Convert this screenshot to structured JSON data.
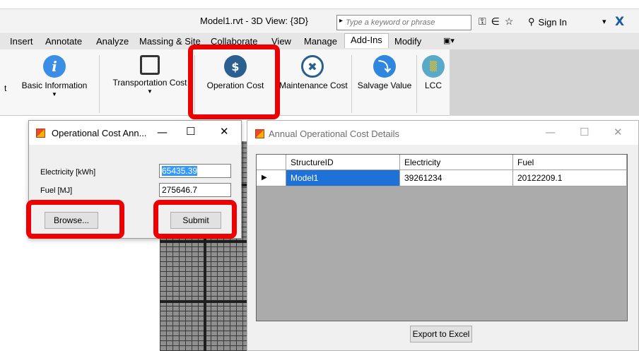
{
  "titlebar": {
    "app_title": "Model1.rvt - 3D View: {3D}",
    "search_placeholder": "Type a keyword or phrase",
    "sign_in": "Sign In"
  },
  "ribbon": {
    "tabs": [
      {
        "label": "Insert"
      },
      {
        "label": "Annotate"
      },
      {
        "label": "Analyze"
      },
      {
        "label": "Massing & Site"
      },
      {
        "label": "Collaborate"
      },
      {
        "label": "View"
      },
      {
        "label": "Manage"
      },
      {
        "label": "Add-Ins",
        "active": true
      },
      {
        "label": "Modify"
      }
    ],
    "buttons": [
      {
        "label": "Basic Information",
        "icon": "info-icon",
        "color": "#3a8ee6"
      },
      {
        "label": "Transportation Cost",
        "icon": "truck-icon",
        "color": "#333333"
      },
      {
        "label": "Operation Cost",
        "icon": "money-hand-icon",
        "color": "#2b5f8f"
      },
      {
        "label": "Maintenance Cost",
        "icon": "tools-icon",
        "color": "#2b5f8f"
      },
      {
        "label": "Salvage Value",
        "icon": "salvage-arrow-icon",
        "color": "#2e86de"
      },
      {
        "label": "LCC",
        "icon": "bar-chart-icon",
        "color": "#5aa9c9"
      }
    ]
  },
  "dialog_small": {
    "title": "Operational Cost Ann...",
    "electricity_label": "Electricity [kWh]",
    "electricity_value": "65435.39",
    "fuel_label": "Fuel [MJ]",
    "fuel_value": "275646.7",
    "browse_label": "Browse...",
    "submit_label": "Submit"
  },
  "dialog_large": {
    "title": "Annual Operational Cost Details",
    "columns": [
      "StructureID",
      "Electricity",
      "Fuel"
    ],
    "rows": [
      {
        "structure_id": "Model1",
        "electricity": "39261234",
        "fuel": "20122209.1"
      }
    ],
    "export_label": "Export to Excel"
  },
  "colors": {
    "highlight": "#ee0000",
    "selection": "#1e71d7"
  }
}
